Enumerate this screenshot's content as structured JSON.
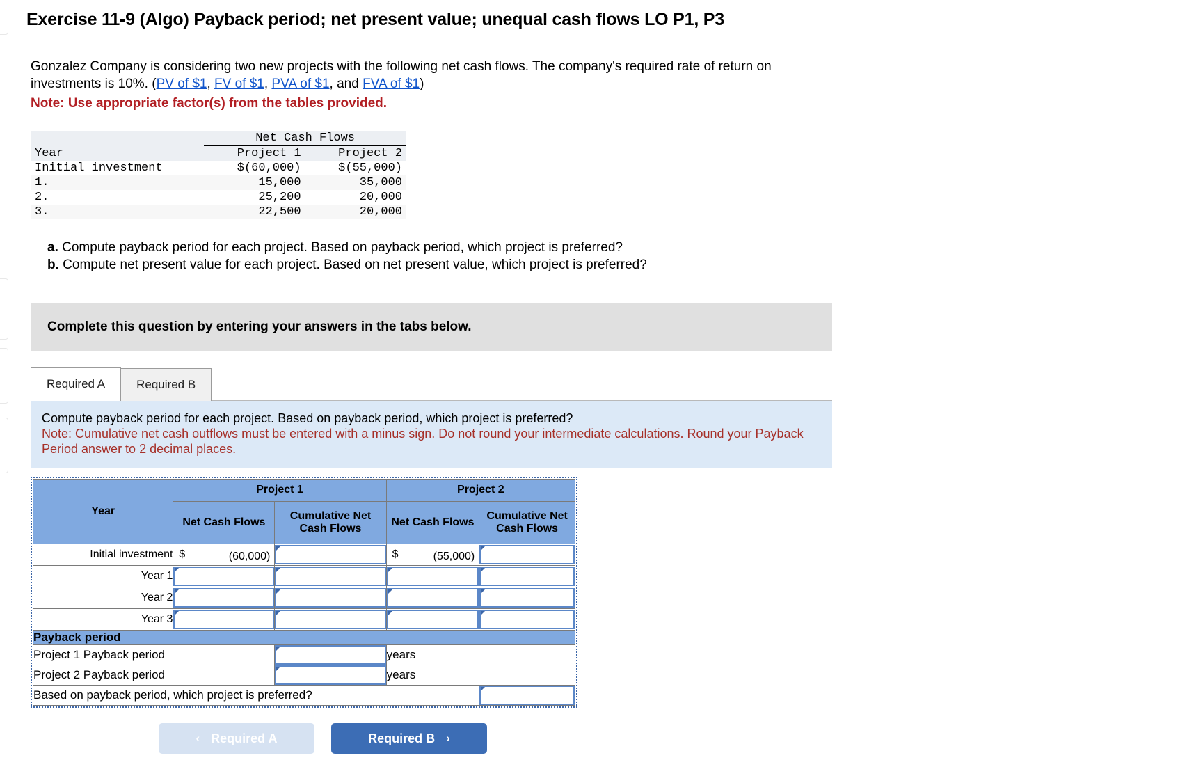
{
  "title": "Exercise 11-9 (Algo) Payback period; net present value; unequal cash flows LO P1, P3",
  "intro": {
    "line1": "Gonzalez Company is considering two new projects with the following net cash flows. The company's required rate of return on",
    "line2_pre": "investments is 10%. (",
    "link1": "PV of $1",
    "sep1": ", ",
    "link2": "FV of $1",
    "sep2": ", ",
    "link3": "PVA of $1",
    "sep3": ", and ",
    "link4": "FVA of $1",
    "line2_post": ")",
    "note": "Note: Use appropriate factor(s) from the tables provided."
  },
  "cash_flow_table": {
    "group_header": "Net Cash Flows",
    "col_year": "Year",
    "col_p1": "Project 1",
    "col_p2": "Project 2",
    "rows": [
      {
        "year": "Initial investment",
        "p1": "$(60,000)",
        "p2": "$(55,000)"
      },
      {
        "year": "1.",
        "p1": "15,000",
        "p2": "35,000"
      },
      {
        "year": "2.",
        "p1": "25,200",
        "p2": "20,000"
      },
      {
        "year": "3.",
        "p1": "22,500",
        "p2": "20,000"
      }
    ]
  },
  "requirements": {
    "a_marker": "a.",
    "a_text": "Compute payback period for each project. Based on payback period, which project is preferred?",
    "b_marker": "b.",
    "b_text": "Compute net present value for each project. Based on net present value, which project is preferred?"
  },
  "banner": "Complete this question by entering your answers in the tabs below.",
  "tabs": [
    {
      "label": "Required A",
      "active": true
    },
    {
      "label": "Required B",
      "active": false
    }
  ],
  "instruction": {
    "prompt": "Compute payback period for each project. Based on payback period, which project is preferred?",
    "note": "Note: Cumulative net cash outflows must be entered with a minus sign. Do not round your intermediate calculations. Round your Payback Period answer to 2 decimal places."
  },
  "answer_table": {
    "headers": {
      "year": "Year",
      "project1": "Project 1",
      "project2": "Project 2",
      "p1_ncf": "Net Cash Flows",
      "p1_cum": "Cumulative Net Cash Flows",
      "p2_ncf": "Net Cash Flows",
      "p2_cum": "Cumulative Net Cash Flows"
    },
    "rows": [
      {
        "label": "Initial investment",
        "p1_ncf_dollar": "$",
        "p1_ncf_value": "(60,000)",
        "p1_cum_value": "",
        "p2_ncf_dollar": "$",
        "p2_ncf_value": "(55,000)",
        "p2_cum_value": ""
      },
      {
        "label": "Year 1",
        "p1_ncf_value": "",
        "p1_cum_value": "",
        "p2_ncf_value": "",
        "p2_cum_value": ""
      },
      {
        "label": "Year 2",
        "p1_ncf_value": "",
        "p1_cum_value": "",
        "p2_ncf_value": "",
        "p2_cum_value": ""
      },
      {
        "label": "Year 3",
        "p1_ncf_value": "",
        "p1_cum_value": "",
        "p2_ncf_value": "",
        "p2_cum_value": ""
      }
    ],
    "payback_band": "Payback period",
    "payback_rows": [
      {
        "label": "Project 1 Payback period",
        "value": "",
        "units": "years"
      },
      {
        "label": "Project 2 Payback period",
        "value": "",
        "units": "years"
      }
    ],
    "preferred_question": "Based on payback period, which project is preferred?",
    "preferred_answer": ""
  },
  "footer": {
    "prev_label": "Required A",
    "prev_chevron": "‹",
    "next_label": "Required B",
    "next_chevron": "›"
  },
  "colors": {
    "header_blue": "#80a9e0",
    "panel_blue": "#dce9f7",
    "note_red": "#b21f24",
    "instr_red": "#a63029",
    "link_blue": "#1155cc",
    "btn_next": "#3c6db5",
    "btn_prev": "#d6e2f2",
    "banner_grey": "#e0e0e0"
  }
}
